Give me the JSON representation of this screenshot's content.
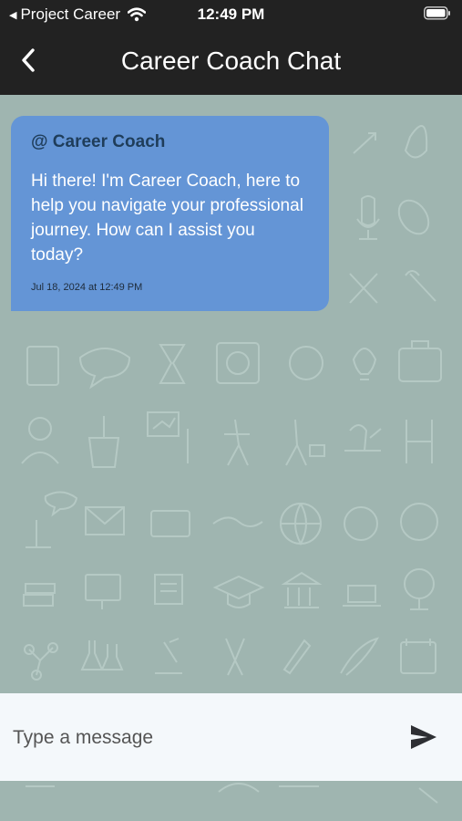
{
  "status_bar": {
    "back_app": "Project Career",
    "time": "12:49 PM"
  },
  "nav": {
    "title": "Career Coach Chat"
  },
  "messages": [
    {
      "sender": "@ Career Coach",
      "text": "Hi there! I'm Career Coach, here to help you navigate your professional journey. How can I assist you today?",
      "timestamp": "Jul 18, 2024 at 12:49 PM"
    }
  ],
  "composer": {
    "placeholder": "Type a message"
  },
  "colors": {
    "bar_background": "#222222",
    "chat_background": "#9fb5b0",
    "bubble": "#6495d6",
    "sender_text": "#1f3d5a"
  },
  "icons": {
    "back": "chevron-left-icon",
    "send": "send-icon",
    "wifi": "wifi-icon",
    "battery": "battery-icon"
  }
}
